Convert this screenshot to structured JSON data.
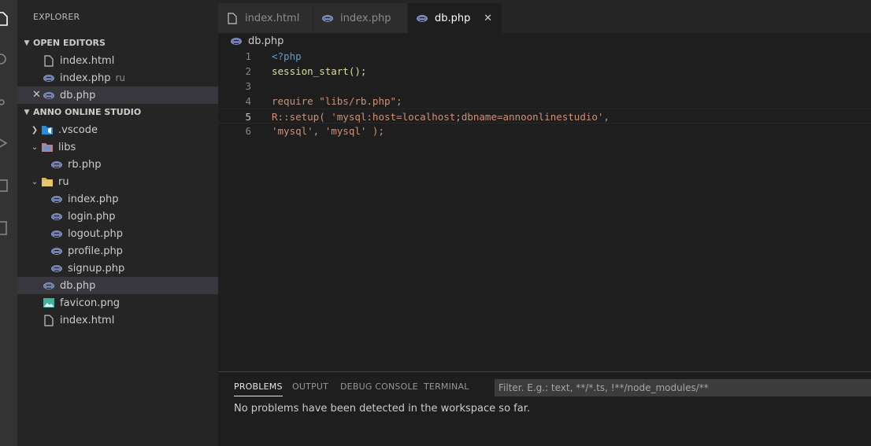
{
  "sidebar": {
    "title": "EXPLORER",
    "open_editors": {
      "header": "OPEN EDITORS",
      "items": [
        {
          "name": "index.html",
          "desc": ""
        },
        {
          "name": "index.php",
          "desc": "ru"
        },
        {
          "name": "db.php",
          "desc": ""
        }
      ]
    },
    "workspace": {
      "header": "ANNO ONLINE STUDIO",
      "items": [
        {
          "name": ".vscode"
        },
        {
          "name": "libs"
        },
        {
          "name": "rb.php"
        },
        {
          "name": "ru"
        },
        {
          "name": "index.php"
        },
        {
          "name": "login.php"
        },
        {
          "name": "logout.php"
        },
        {
          "name": "profile.php"
        },
        {
          "name": "signup.php"
        },
        {
          "name": "db.php"
        },
        {
          "name": "favicon.png"
        },
        {
          "name": "index.html"
        }
      ]
    }
  },
  "tabs": [
    {
      "label": "index.html",
      "active": false
    },
    {
      "label": "index.php",
      "active": false
    },
    {
      "label": "db.php",
      "active": true
    }
  ],
  "breadcrumb": "db.php",
  "editor": {
    "line_numbers": [
      "1",
      "2",
      "3",
      "4",
      "5",
      "6"
    ],
    "lines": [
      "<?php",
      "session_start();",
      "",
      "require \"libs/rb.php\";",
      "R::setup( 'mysql:host=localhost;dbname=annoonlinestudio',",
      "'mysql', 'mysql' );"
    ]
  },
  "panel": {
    "tabs": [
      "PROBLEMS",
      "OUTPUT",
      "DEBUG CONSOLE",
      "TERMINAL"
    ],
    "filter_placeholder": "Filter. E.g.: text, **/*.ts, !**/node_modules/**",
    "message": "No problems have been detected in the workspace so far."
  },
  "icons": {
    "file": "file-icon",
    "php": "php-icon",
    "folder": "folder-icon",
    "vscode_folder": "vscode-folder-icon",
    "image": "image-icon",
    "close": "close-icon",
    "chevron_right": "chevron-right-icon",
    "chevron_down": "chevron-down-icon"
  },
  "colors": {
    "keyword": "#569cd6",
    "tag": "#569cd6",
    "function": "#dcdcaa",
    "string": "#ce9178",
    "class": "#4ec9b0",
    "plain": "#d4d4d4"
  }
}
